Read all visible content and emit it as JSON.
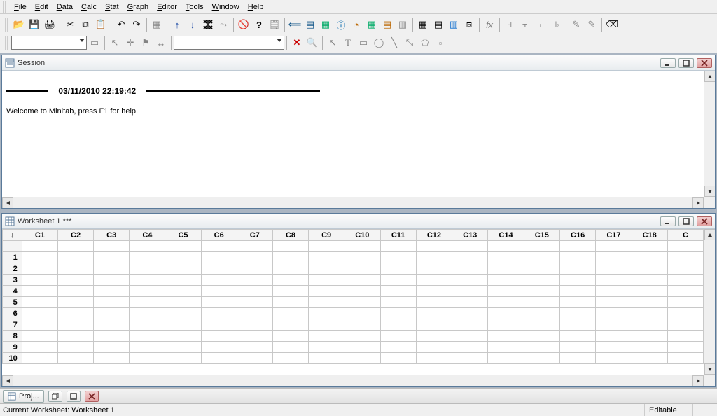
{
  "menu": [
    "File",
    "Edit",
    "Data",
    "Calc",
    "Stat",
    "Graph",
    "Editor",
    "Tools",
    "Window",
    "Help"
  ],
  "session": {
    "title": "Session",
    "timestamp": "03/11/2010 22:19:42",
    "welcome": "Welcome to Minitab, press F1 for help."
  },
  "worksheet": {
    "title": "Worksheet 1 ***",
    "columns": [
      "C1",
      "C2",
      "C3",
      "C4",
      "C5",
      "C6",
      "C7",
      "C8",
      "C9",
      "C10",
      "C11",
      "C12",
      "C13",
      "C14",
      "C15",
      "C16",
      "C17",
      "C18"
    ],
    "last_col_hint": "C",
    "rows": [
      1,
      2,
      3,
      4,
      5,
      6,
      7,
      8,
      9,
      10
    ]
  },
  "taskbar": {
    "item": "Proj..."
  },
  "status": {
    "left": "Current Worksheet: Worksheet 1",
    "right": "Editable"
  }
}
